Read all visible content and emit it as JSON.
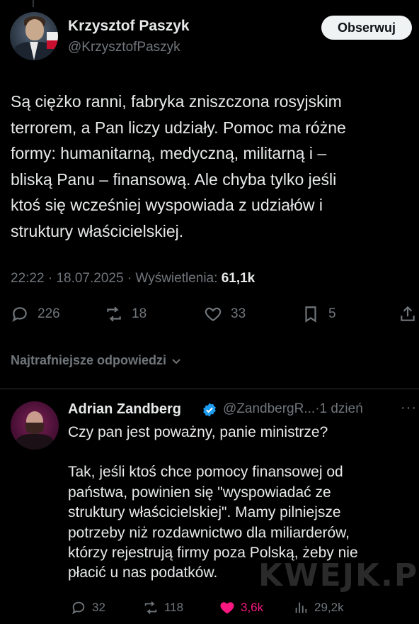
{
  "post": {
    "author_name": "Krzysztof Paszyk",
    "author_handle": "@KrzysztofPaszyk",
    "follow_label": "Obserwuj",
    "text_lines": [
      "Są ciężko ranni, fabryka zniszczona rosyjskim",
      "terrorem, a Pan liczy udziały. Pomoc ma różne",
      "formy: humanitarną, medyczną, militarną i –",
      "bliską Panu – finansową. Ale chyba tylko jeśli",
      "ktoś się wcześniej wyspowiada z udziałów i",
      "struktury właścicielskiej."
    ],
    "time": "22:22",
    "date": "18.07.2025",
    "views_label": "Wyświetlenia:",
    "views_count": "61,1k",
    "sep": "·",
    "actions": {
      "replies": "226",
      "reposts": "18",
      "likes": "33",
      "bookmarks": "5"
    }
  },
  "replies_sort_label": "Najtrafniejsze odpowiedzi",
  "reply": {
    "author_name": "Adrian Zandberg",
    "author_handle": "@ZandbergR...",
    "age": "1 dzień",
    "sep": "·",
    "more": "···",
    "verified_color": "#1d9bf0",
    "text_lines_1": [
      "Czy pan jest poważny, panie ministrze?"
    ],
    "text_lines_2": [
      "Tak, jeśli ktoś chce pomocy finansowej od",
      "państwa, powinien się \"wyspowiadać ze",
      "struktury właścicielskiej\". Mamy pilniejsze",
      "potrzeby niż rozdawnictwo dla miliarderów,",
      "którzy rejestrują firmy poza Polską, żeby nie",
      "płacić u nas podatków."
    ],
    "actions": {
      "replies": "32",
      "reposts": "118",
      "likes": "3,6k",
      "views": "29,2k"
    },
    "like_color": "#f91880"
  },
  "watermark": "KWEJK.PL",
  "icons": [
    "reply-icon",
    "repost-icon",
    "like-icon",
    "bookmark-icon",
    "share-icon",
    "chevron-down-icon",
    "verified-icon",
    "views-icon",
    "more-icon"
  ]
}
